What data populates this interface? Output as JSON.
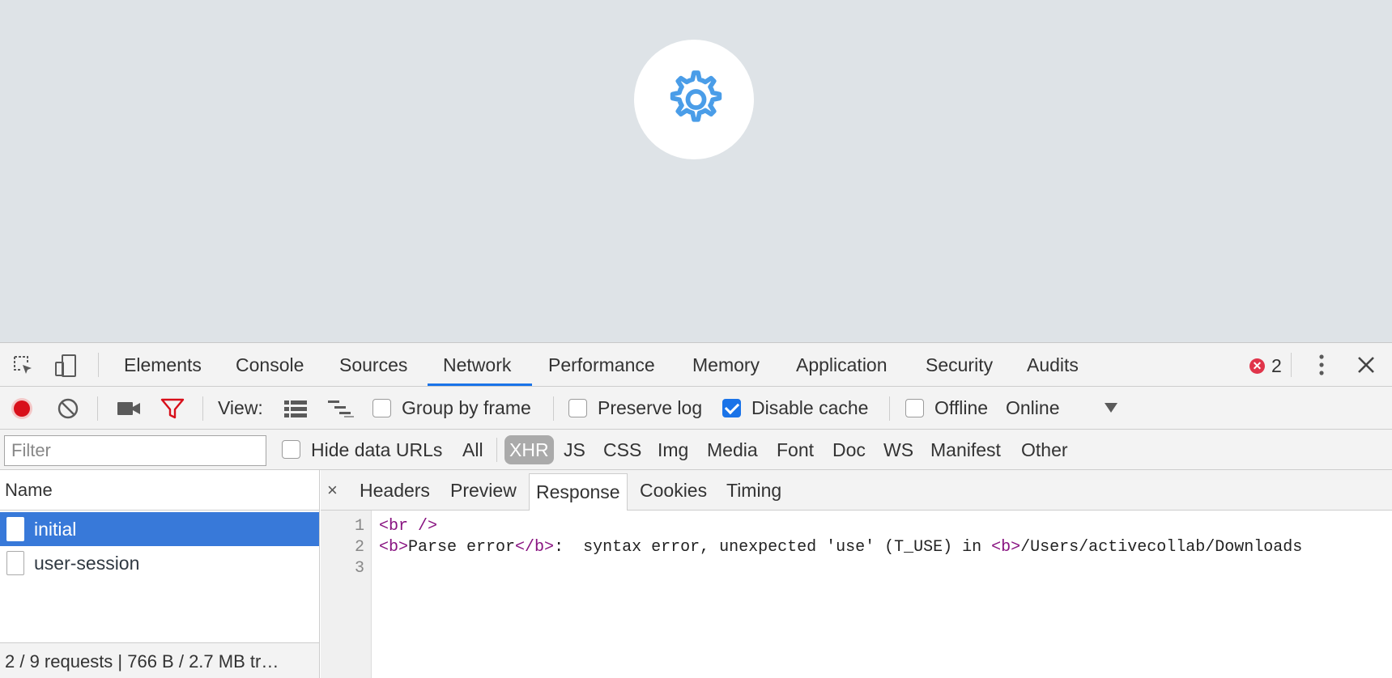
{
  "page": {
    "gear_icon": "gear-icon",
    "accent": "#4a9de8"
  },
  "devtools": {
    "tabs": [
      "Elements",
      "Console",
      "Sources",
      "Network",
      "Performance",
      "Memory",
      "Application",
      "Security",
      "Audits"
    ],
    "active_tab": "Network",
    "error_count": "2",
    "toolbar": {
      "view_label": "View:",
      "group_by_frame": {
        "label": "Group by frame",
        "checked": false
      },
      "preserve_log": {
        "label": "Preserve log",
        "checked": false
      },
      "disable_cache": {
        "label": "Disable cache",
        "checked": true
      },
      "offline": {
        "label": "Offline",
        "checked": false
      },
      "throttle": "Online"
    },
    "filter": {
      "placeholder": "Filter",
      "hide_data_urls": {
        "label": "Hide data URLs",
        "checked": false
      },
      "types": [
        "All",
        "XHR",
        "JS",
        "CSS",
        "Img",
        "Media",
        "Font",
        "Doc",
        "WS",
        "Manifest",
        "Other"
      ],
      "active_type": "XHR"
    },
    "requests": {
      "header": "Name",
      "items": [
        {
          "name": "initial",
          "selected": true
        },
        {
          "name": "user-session",
          "selected": false
        }
      ],
      "summary": "2 / 9 requests | 766 B / 2.7 MB tr…"
    },
    "detail": {
      "close": "×",
      "tabs": [
        "Headers",
        "Preview",
        "Response",
        "Cookies",
        "Timing"
      ],
      "active_tab": "Response",
      "lines": [
        {
          "n": "1",
          "parts": [
            {
              "t": "<br />",
              "tag": true
            }
          ]
        },
        {
          "n": "2",
          "parts": [
            {
              "t": "<b>",
              "tag": true
            },
            {
              "t": "Parse error",
              "tag": false
            },
            {
              "t": "</b>",
              "tag": true
            },
            {
              "t": ":  syntax error, unexpected 'use' (T_USE) in ",
              "tag": false
            },
            {
              "t": "<b>",
              "tag": true
            },
            {
              "t": "/Users/activecollab/Downloads",
              "tag": false
            }
          ]
        },
        {
          "n": "3",
          "parts": []
        }
      ]
    }
  }
}
